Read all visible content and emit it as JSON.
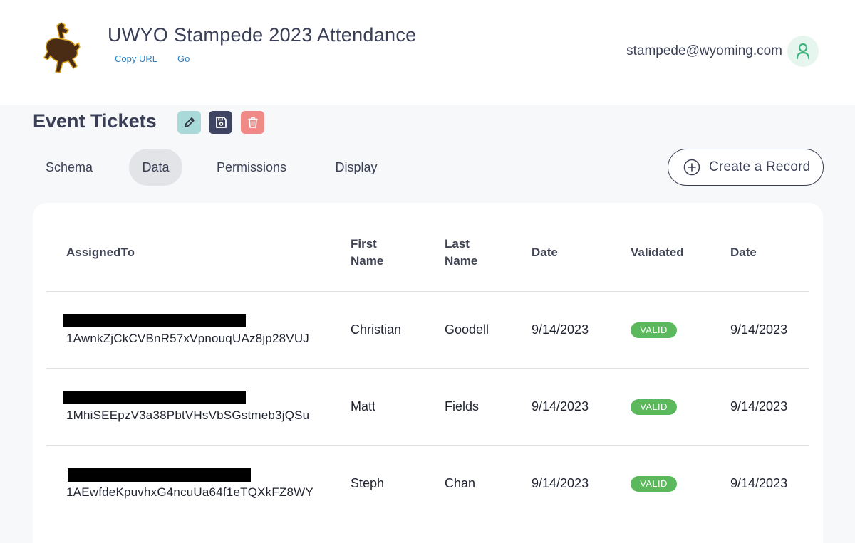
{
  "app": {
    "title": "UWYO Stampede 2023 Attendance",
    "copy_url_label": "Copy URL",
    "go_label": "Go",
    "user_email": "stampede@wyoming.com",
    "logo_icon": "bucking-horse-logo",
    "avatar_icon": "user-icon"
  },
  "section": {
    "title": "Event Tickets",
    "tools": [
      "pencil-icon",
      "save-icon",
      "trash-icon"
    ]
  },
  "tabs": [
    {
      "label": "Schema"
    },
    {
      "label": "Data",
      "active": true
    },
    {
      "label": "Permissions"
    },
    {
      "label": "Display"
    }
  ],
  "create_button": {
    "label": "Create a Record",
    "icon": "plus-circle-icon"
  },
  "table": {
    "columns": [
      "AssignedTo",
      "First\nName",
      "Last\nName",
      "Date",
      "Validated",
      "Date"
    ],
    "rows": [
      {
        "assigned_id": "1AwnkZjCkCVBnR57xVpnouqUAz8jp28VUJ",
        "first": "Christian",
        "last": "Goodell",
        "date": "9/14/2023",
        "validated": "VALID",
        "date2": "9/14/2023"
      },
      {
        "assigned_id": "1MhiSEEpzV3a38PbtVHsVbSGstmeb3jQSu",
        "first": "Matt",
        "last": "Fields",
        "date": "9/14/2023",
        "validated": "VALID",
        "date2": "9/14/2023"
      },
      {
        "assigned_id": "1AEwfdeKpuvhxG4ncuUa64f1eTQXkFZ8WY",
        "first": "Steph",
        "last": "Chan",
        "date": "9/14/2023",
        "validated": "VALID",
        "date2": "9/14/2023"
      }
    ]
  },
  "colors": {
    "accent_link": "#2f7fc1",
    "valid_badge": "#5bb85d",
    "edit_button": "#a9d9d8",
    "save_button": "#3e4461",
    "delete_button": "#ef8a86"
  }
}
